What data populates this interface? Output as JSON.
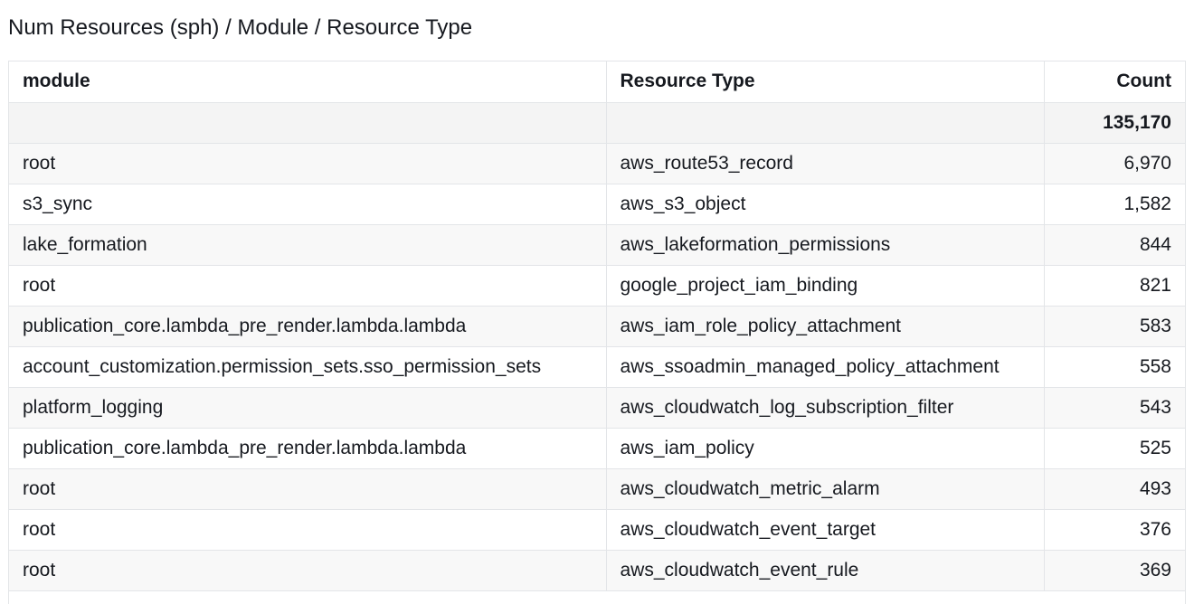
{
  "title": "Num Resources (sph) / Module / Resource Type",
  "table": {
    "columns": [
      "module",
      "Resource Type",
      "Count"
    ],
    "total": {
      "module": "",
      "resource_type": "",
      "count": "135,170"
    },
    "rows": [
      {
        "module": "root",
        "resource_type": "aws_route53_record",
        "count": "6,970"
      },
      {
        "module": "s3_sync",
        "resource_type": "aws_s3_object",
        "count": "1,582"
      },
      {
        "module": "lake_formation",
        "resource_type": "aws_lakeformation_permissions",
        "count": "844"
      },
      {
        "module": "root",
        "resource_type": "google_project_iam_binding",
        "count": "821"
      },
      {
        "module": "publication_core.lambda_pre_render.lambda.lambda",
        "resource_type": "aws_iam_role_policy_attachment",
        "count": "583"
      },
      {
        "module": "account_customization.permission_sets.sso_permission_sets",
        "resource_type": "aws_ssoadmin_managed_policy_attachment",
        "count": "558"
      },
      {
        "module": "platform_logging",
        "resource_type": "aws_cloudwatch_log_subscription_filter",
        "count": "543"
      },
      {
        "module": "publication_core.lambda_pre_render.lambda.lambda",
        "resource_type": "aws_iam_policy",
        "count": "525"
      },
      {
        "module": "root",
        "resource_type": "aws_cloudwatch_metric_alarm",
        "count": "493"
      },
      {
        "module": "root",
        "resource_type": "aws_cloudwatch_event_target",
        "count": "376"
      },
      {
        "module": "root",
        "resource_type": "aws_cloudwatch_event_rule",
        "count": "369"
      }
    ]
  }
}
